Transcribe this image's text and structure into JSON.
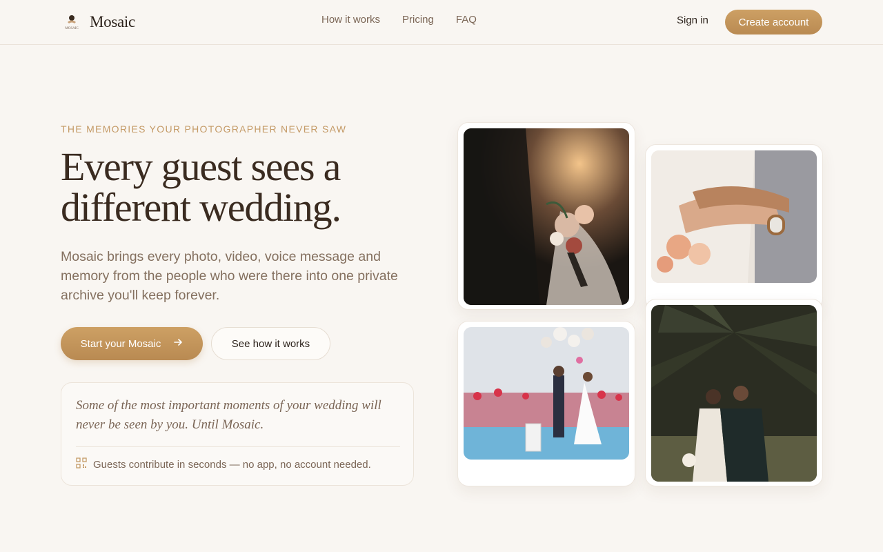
{
  "header": {
    "brand": "Mosaic",
    "logo_text": "MOSAIC",
    "nav": [
      "How it works",
      "Pricing",
      "FAQ"
    ],
    "sign_in": "Sign in",
    "create_account": "Create account"
  },
  "hero": {
    "eyebrow": "THE MEMORIES YOUR PHOTOGRAPHER NEVER SAW",
    "headline": "Every guest sees a different wedding.",
    "subtext": "Mosaic brings every photo, video, voice message and memory from the people who were there into one private archive you'll keep forever.",
    "primary_cta": "Start your Mosaic",
    "secondary_cta": "See how it works",
    "quote": "Some of the most important moments of your wedding will never be seen by you. Until Mosaic.",
    "quote_foot": "Guests contribute in seconds — no app, no account needed."
  },
  "photos": [
    {
      "subject": "bride holding bouquet"
    },
    {
      "subject": "couple holding hands with rings"
    },
    {
      "subject": "couple with balloons by pool"
    },
    {
      "subject": "couple walking under palm tree"
    }
  ],
  "icons": {
    "primary_cta_icon": "arrow-right-icon",
    "quote_foot_icon": "qr-code-icon"
  },
  "colors": {
    "accent": "#c49a66",
    "button": "#c29358",
    "background": "#f9f6f2",
    "heading": "#3a2b20"
  }
}
